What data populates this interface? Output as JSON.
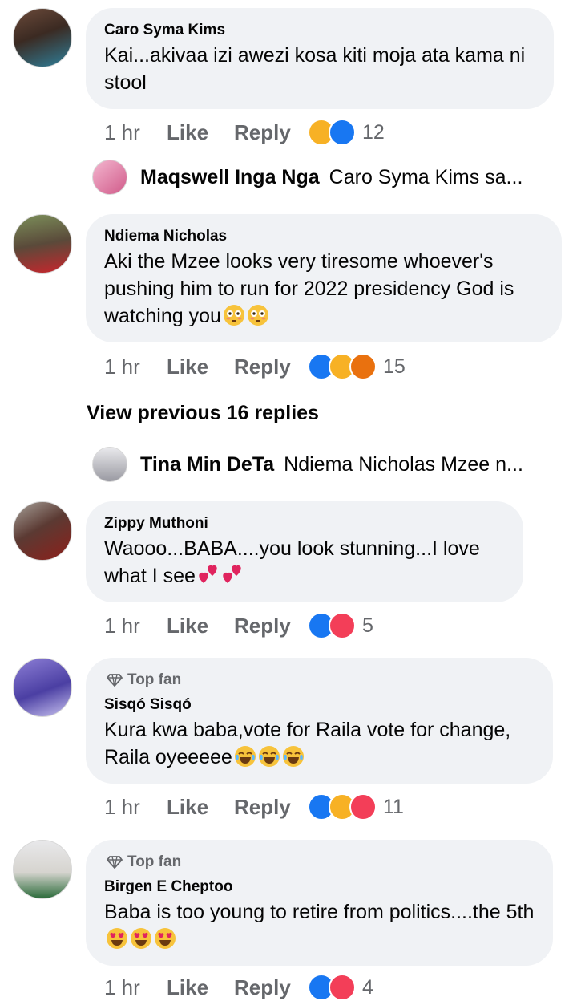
{
  "comments": [
    {
      "author": "Caro Syma Kims",
      "text": "Kai...akivaa izi awezi kosa kiti moja ata kama ni stool",
      "time": "1 hr",
      "like": "Like",
      "reply": "Reply",
      "reaction_count": "12",
      "reactions": [
        "haha",
        "like"
      ]
    },
    {
      "author": "Ndiema Nicholas",
      "text": "Aki the Mzee looks very tiresome whoever's pushing him to run for 2022 presidency God is watching you",
      "emoji": "flushed-face-icon",
      "time": "1 hr",
      "like": "Like",
      "reply": "Reply",
      "reaction_count": "15",
      "reactions": [
        "like",
        "haha",
        "angry"
      ]
    },
    {
      "author": "Zippy Muthoni",
      "text": "Waooo...BABA....you look stunning...I love what I see",
      "emoji": "two-hearts-icon",
      "time": "1 hr",
      "like": "Like",
      "reply": "Reply",
      "reaction_count": "5",
      "reactions": [
        "like",
        "love"
      ]
    },
    {
      "author": "Sisqó Sisqó",
      "badge": "Top fan",
      "text": "Kura kwa baba,vote for Raila vote for change, Raila oyeeeee",
      "emoji": "tears-of-joy-icon",
      "time": "1 hr",
      "like": "Like",
      "reply": "Reply",
      "reaction_count": "11",
      "reactions": [
        "like",
        "haha",
        "love"
      ]
    },
    {
      "author": "Birgen E Cheptoo",
      "badge": "Top fan",
      "text": "Baba is too young to retire from politics....the 5th",
      "emoji": "heart-eyes-icon",
      "time": "1 hr",
      "like": "Like",
      "reply": "Reply",
      "reaction_count": "4",
      "reactions": [
        "like",
        "love"
      ]
    }
  ],
  "replies": [
    {
      "author": "Maqswell Inga Nga",
      "snippet": "Caro Syma Kims sa..."
    },
    {
      "author": "Tina Min DeTa",
      "snippet": "Ndiema Nicholas Mzee n..."
    }
  ],
  "view_previous": "View previous 16 replies",
  "colors": {
    "bubble": "#f0f2f5",
    "meta": "#65676b",
    "like_blue": "#1877f2",
    "haha": "#f7b125",
    "love": "#f33e58",
    "angry": "#e9710f"
  }
}
